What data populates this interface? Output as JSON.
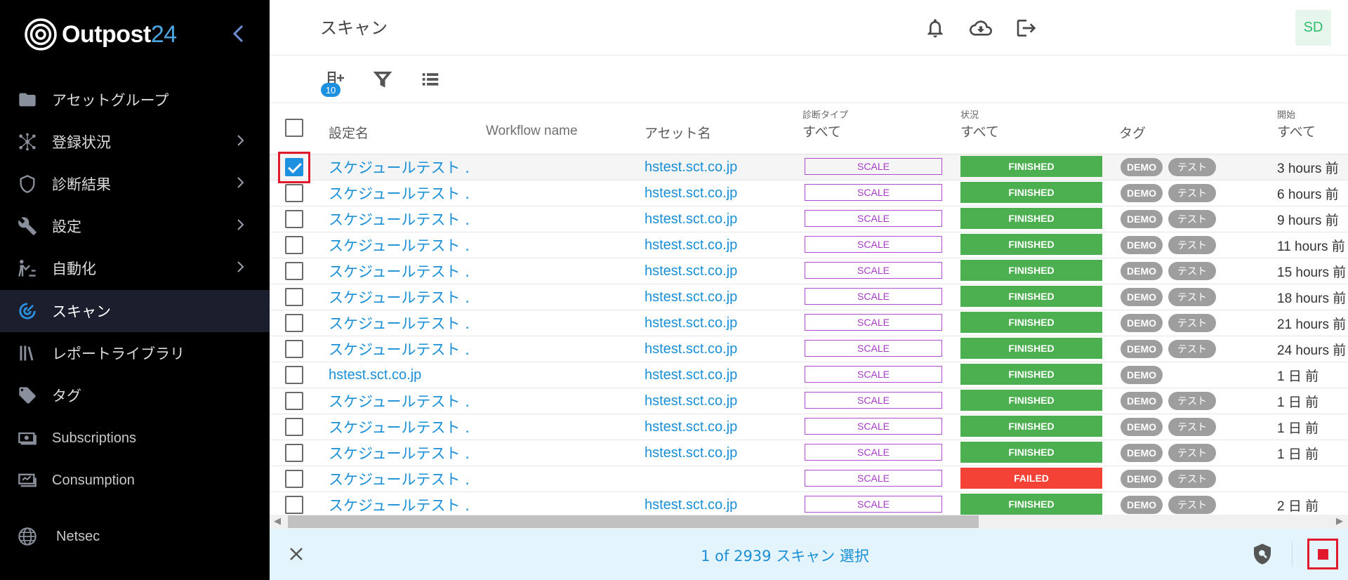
{
  "app": {
    "logo_text": "Outpost",
    "logo_num": "24"
  },
  "sidebar": {
    "items": [
      {
        "label": "アセットグループ",
        "icon": "folder-icon",
        "chevron": false,
        "active": false
      },
      {
        "label": "登録状況",
        "icon": "network-icon",
        "chevron": true,
        "active": false
      },
      {
        "label": "診断結果",
        "icon": "shield-icon",
        "chevron": true,
        "active": false
      },
      {
        "label": "設定",
        "icon": "wrench-icon",
        "chevron": true,
        "active": false
      },
      {
        "label": "自動化",
        "icon": "automation-icon",
        "chevron": true,
        "active": false
      },
      {
        "label": "スキャン",
        "icon": "radar-icon",
        "chevron": false,
        "active": true
      },
      {
        "label": "レポートライブラリ",
        "icon": "library-icon",
        "chevron": false,
        "active": false
      },
      {
        "label": "タグ",
        "icon": "tag-icon",
        "chevron": false,
        "active": false
      },
      {
        "label": "Subscriptions",
        "icon": "subscriptions-icon",
        "chevron": false,
        "active": false
      },
      {
        "label": "Consumption",
        "icon": "consumption-icon",
        "chevron": false,
        "active": false
      },
      {
        "label": "Netsec",
        "icon": "globe-icon",
        "chevron": false,
        "active": false
      }
    ]
  },
  "header": {
    "title": "スキャン",
    "avatar": "SD"
  },
  "toolbar": {
    "queue_count": "10"
  },
  "table": {
    "headers": {
      "name": "設定名",
      "workflow": "Workflow name",
      "asset": "アセット名",
      "type_label": "診断タイプ",
      "type_filter": "すべて",
      "status_label": "状況",
      "status_filter": "すべて",
      "tags": "タグ",
      "start_label": "開始",
      "start_filter": "すべて"
    },
    "rows": [
      {
        "name": "スケジュールテスト ...",
        "asset": "hstest.sct.co.jp",
        "type": "SCALE",
        "status": "FINISHED",
        "tags": [
          "DEMO",
          "テスト"
        ],
        "start": "3 hours 前",
        "checked": true
      },
      {
        "name": "スケジュールテスト ...",
        "asset": "hstest.sct.co.jp",
        "type": "SCALE",
        "status": "FINISHED",
        "tags": [
          "DEMO",
          "テスト"
        ],
        "start": "6 hours 前",
        "checked": false
      },
      {
        "name": "スケジュールテスト ...",
        "asset": "hstest.sct.co.jp",
        "type": "SCALE",
        "status": "FINISHED",
        "tags": [
          "DEMO",
          "テスト"
        ],
        "start": "9 hours 前",
        "checked": false
      },
      {
        "name": "スケジュールテスト ...",
        "asset": "hstest.sct.co.jp",
        "type": "SCALE",
        "status": "FINISHED",
        "tags": [
          "DEMO",
          "テスト"
        ],
        "start": "11 hours 前",
        "checked": false
      },
      {
        "name": "スケジュールテスト ...",
        "asset": "hstest.sct.co.jp",
        "type": "SCALE",
        "status": "FINISHED",
        "tags": [
          "DEMO",
          "テスト"
        ],
        "start": "15 hours 前",
        "checked": false
      },
      {
        "name": "スケジュールテスト ...",
        "asset": "hstest.sct.co.jp",
        "type": "SCALE",
        "status": "FINISHED",
        "tags": [
          "DEMO",
          "テスト"
        ],
        "start": "18 hours 前",
        "checked": false
      },
      {
        "name": "スケジュールテスト ...",
        "asset": "hstest.sct.co.jp",
        "type": "SCALE",
        "status": "FINISHED",
        "tags": [
          "DEMO",
          "テスト"
        ],
        "start": "21 hours 前",
        "checked": false
      },
      {
        "name": "スケジュールテスト ...",
        "asset": "hstest.sct.co.jp",
        "type": "SCALE",
        "status": "FINISHED",
        "tags": [
          "DEMO",
          "テスト"
        ],
        "start": "24 hours 前",
        "checked": false
      },
      {
        "name": "hstest.sct.co.jp",
        "asset": "hstest.sct.co.jp",
        "type": "SCALE",
        "status": "FINISHED",
        "tags": [
          "DEMO"
        ],
        "start": "1 日 前",
        "checked": false
      },
      {
        "name": "スケジュールテスト ...",
        "asset": "hstest.sct.co.jp",
        "type": "SCALE",
        "status": "FINISHED",
        "tags": [
          "DEMO",
          "テスト"
        ],
        "start": "1 日 前",
        "checked": false
      },
      {
        "name": "スケジュールテスト ...",
        "asset": "hstest.sct.co.jp",
        "type": "SCALE",
        "status": "FINISHED",
        "tags": [
          "DEMO",
          "テスト"
        ],
        "start": "1 日 前",
        "checked": false
      },
      {
        "name": "スケジュールテスト ...",
        "asset": "hstest.sct.co.jp",
        "type": "SCALE",
        "status": "FINISHED",
        "tags": [
          "DEMO",
          "テスト"
        ],
        "start": "1 日 前",
        "checked": false
      },
      {
        "name": "スケジュールテスト ...",
        "asset": "",
        "type": "SCALE",
        "status": "FAILED",
        "tags": [
          "DEMO",
          "テスト"
        ],
        "start": "",
        "checked": false
      },
      {
        "name": "スケジュールテスト ...",
        "asset": "hstest.sct.co.jp",
        "type": "SCALE",
        "status": "FINISHED",
        "tags": [
          "DEMO",
          "テスト"
        ],
        "start": "2 日 前",
        "checked": false
      }
    ]
  },
  "selection": {
    "text": "1 of 2939 スキャン 選択"
  },
  "colors": {
    "finished": "#4caf50",
    "failed": "#f44336",
    "accent": "#1a8fd6",
    "highlight": "#e0192c"
  }
}
